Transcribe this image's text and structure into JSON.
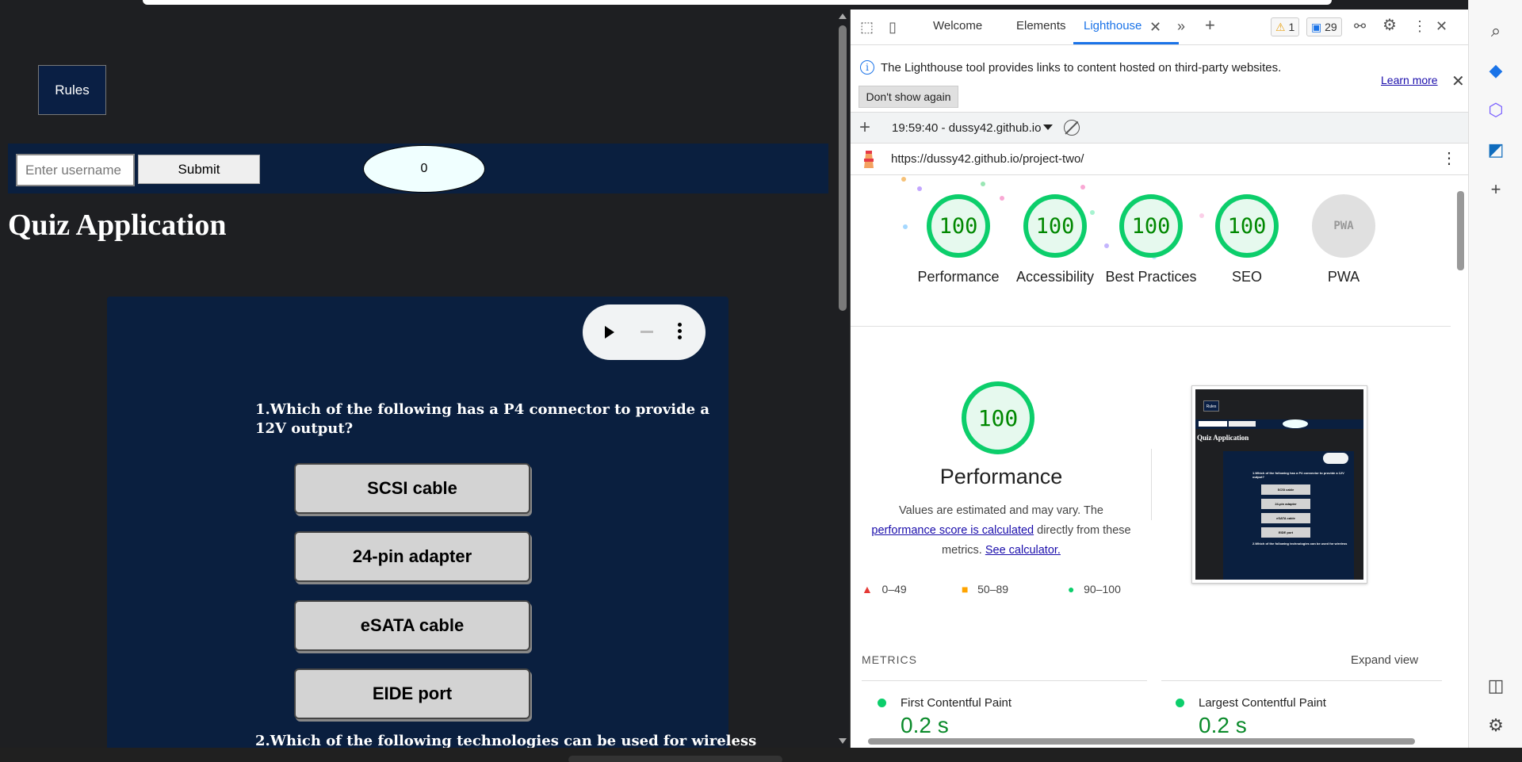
{
  "page": {
    "rules_label": "Rules",
    "username_placeholder": "Enter username",
    "submit_label": "Submit",
    "score": "0",
    "title": "Quiz Application",
    "question1": "1.Which of the following has a P4 connector to provide a 12V output?",
    "answers": [
      "SCSI cable",
      "24-pin adapter",
      "eSATA cable",
      "EIDE port"
    ],
    "question2": "2.Which of the following technologies can be used for wireless"
  },
  "devtools": {
    "tabs": [
      "Welcome",
      "Elements",
      "Lighthouse"
    ],
    "active_tab": "Lighthouse",
    "warnings_count": "1",
    "messages_count": "29",
    "info_text": "The Lighthouse tool provides links to content hosted on third-party websites.",
    "learn_more": "Learn more",
    "dont_show": "Don't show again",
    "run_label": "19:59:40 - dussy42.github.io",
    "url": "https://dussy42.github.io/project-two/"
  },
  "lighthouse": {
    "categories": [
      {
        "label": "Performance",
        "score": "100"
      },
      {
        "label": "Accessibility",
        "score": "100"
      },
      {
        "label": "Best Practices",
        "score": "100"
      },
      {
        "label": "SEO",
        "score": "100"
      },
      {
        "label": "PWA",
        "score": "PWA"
      }
    ],
    "perf_score": "100",
    "perf_title": "Performance",
    "desc_prefix": "Values are estimated and may vary. The",
    "desc_link": "performance score is calculated",
    "desc_mid": "directly from these metrics.",
    "desc_calc": "See calculator.",
    "legend": [
      "0–49",
      "50–89",
      "90–100"
    ],
    "metrics_heading": "METRICS",
    "expand_view": "Expand view",
    "metrics": [
      {
        "name": "First Contentful Paint",
        "value": "0.2 s"
      },
      {
        "name": "Largest Contentful Paint",
        "value": "0.2 s"
      }
    ],
    "thumb": {
      "rules": "Rules",
      "title": "Quiz Application",
      "question": "1.Which of the following has a P4 connector to provide a 12V output?",
      "answers": [
        "SCSI cable",
        "24-pin adapter",
        "eSATA cable",
        "EIDE port"
      ],
      "question2": "2.Which of the following technologies can be used for wireless"
    }
  },
  "colors": {
    "quiz_bg": "#0a1f3f",
    "pass_green": "#0cce6b",
    "accent_blue": "#1a73e8"
  }
}
